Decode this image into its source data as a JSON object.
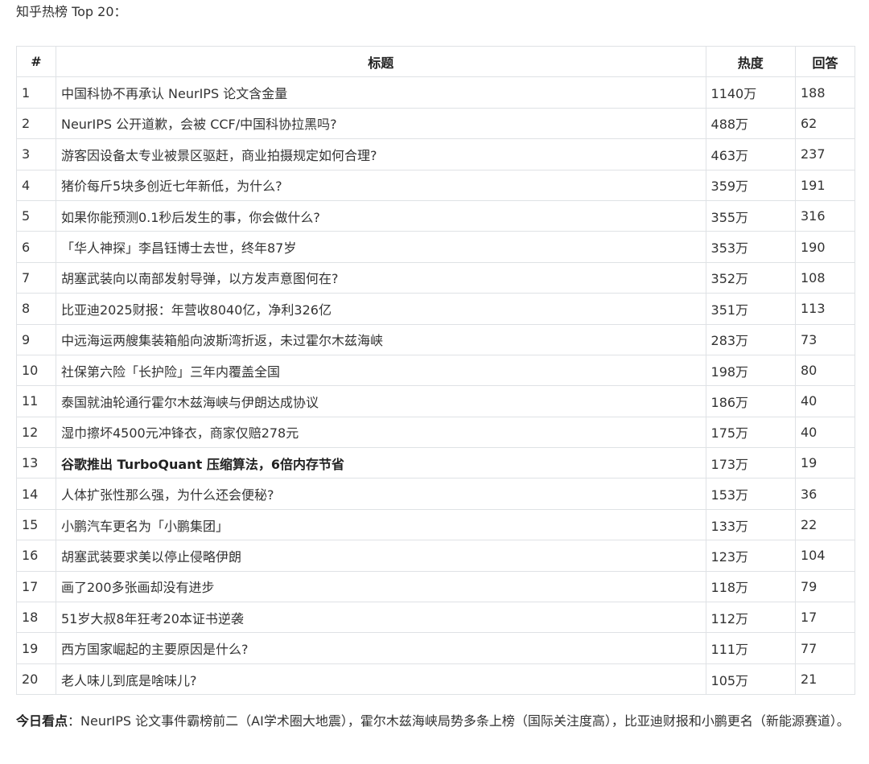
{
  "heading": "知乎热榜 Top 20：",
  "table": {
    "headers": [
      "#",
      "标题",
      "热度",
      "回答"
    ],
    "rows": [
      {
        "rank": "1",
        "title": "中国科协不再承认 NeurIPS 论文含金量",
        "heat": "1140万",
        "answers": "188",
        "bold": false
      },
      {
        "rank": "2",
        "title": "NeurIPS 公开道歉，会被 CCF/中国科协拉黑吗?",
        "heat": "488万",
        "answers": "62",
        "bold": false
      },
      {
        "rank": "3",
        "title": "游客因设备太专业被景区驱赶，商业拍摄规定如何合理?",
        "heat": "463万",
        "answers": "237",
        "bold": false
      },
      {
        "rank": "4",
        "title": "猪价每斤5块多创近七年新低，为什么?",
        "heat": "359万",
        "answers": "191",
        "bold": false
      },
      {
        "rank": "5",
        "title": "如果你能预测0.1秒后发生的事，你会做什么?",
        "heat": "355万",
        "answers": "316",
        "bold": false
      },
      {
        "rank": "6",
        "title": "「华人神探」李昌钰博士去世，终年87岁",
        "heat": "353万",
        "answers": "190",
        "bold": false
      },
      {
        "rank": "7",
        "title": "胡塞武装向以南部发射导弹，以方发声意图何在?",
        "heat": "352万",
        "answers": "108",
        "bold": false
      },
      {
        "rank": "8",
        "title": "比亚迪2025财报：年营收8040亿，净利326亿",
        "heat": "351万",
        "answers": "113",
        "bold": false
      },
      {
        "rank": "9",
        "title": "中远海运两艘集装箱船向波斯湾折返，未过霍尔木兹海峡",
        "heat": "283万",
        "answers": "73",
        "bold": false
      },
      {
        "rank": "10",
        "title": "社保第六险「长护险」三年内覆盖全国",
        "heat": "198万",
        "answers": "80",
        "bold": false
      },
      {
        "rank": "11",
        "title": "泰国就油轮通行霍尔木兹海峡与伊朗达成协议",
        "heat": "186万",
        "answers": "40",
        "bold": false
      },
      {
        "rank": "12",
        "title": "湿巾擦坏4500元冲锋衣，商家仅赔278元",
        "heat": "175万",
        "answers": "40",
        "bold": false
      },
      {
        "rank": "13",
        "title": "谷歌推出 TurboQuant 压缩算法，6倍内存节省",
        "heat": "173万",
        "answers": "19",
        "bold": true
      },
      {
        "rank": "14",
        "title": "人体扩张性那么强，为什么还会便秘?",
        "heat": "153万",
        "answers": "36",
        "bold": false
      },
      {
        "rank": "15",
        "title": "小鹏汽车更名为「小鹏集团」",
        "heat": "133万",
        "answers": "22",
        "bold": false
      },
      {
        "rank": "16",
        "title": "胡塞武装要求美以停止侵略伊朗",
        "heat": "123万",
        "answers": "104",
        "bold": false
      },
      {
        "rank": "17",
        "title": "画了200多张画却没有进步",
        "heat": "118万",
        "answers": "79",
        "bold": false
      },
      {
        "rank": "18",
        "title": "51岁大叔8年狂考20本证书逆袭",
        "heat": "112万",
        "answers": "17",
        "bold": false
      },
      {
        "rank": "19",
        "title": "西方国家崛起的主要原因是什么?",
        "heat": "111万",
        "answers": "77",
        "bold": false
      },
      {
        "rank": "20",
        "title": "老人味儿到底是啥味儿?",
        "heat": "105万",
        "answers": "21",
        "bold": false
      }
    ]
  },
  "summary": {
    "label": "今日看点",
    "text": "：NeurIPS 论文事件霸榜前二（AI学术圈大地震），霍尔木兹海峡局势多条上榜（国际关注度高），比亚迪财报和小鹏更名（新能源赛道）。"
  }
}
